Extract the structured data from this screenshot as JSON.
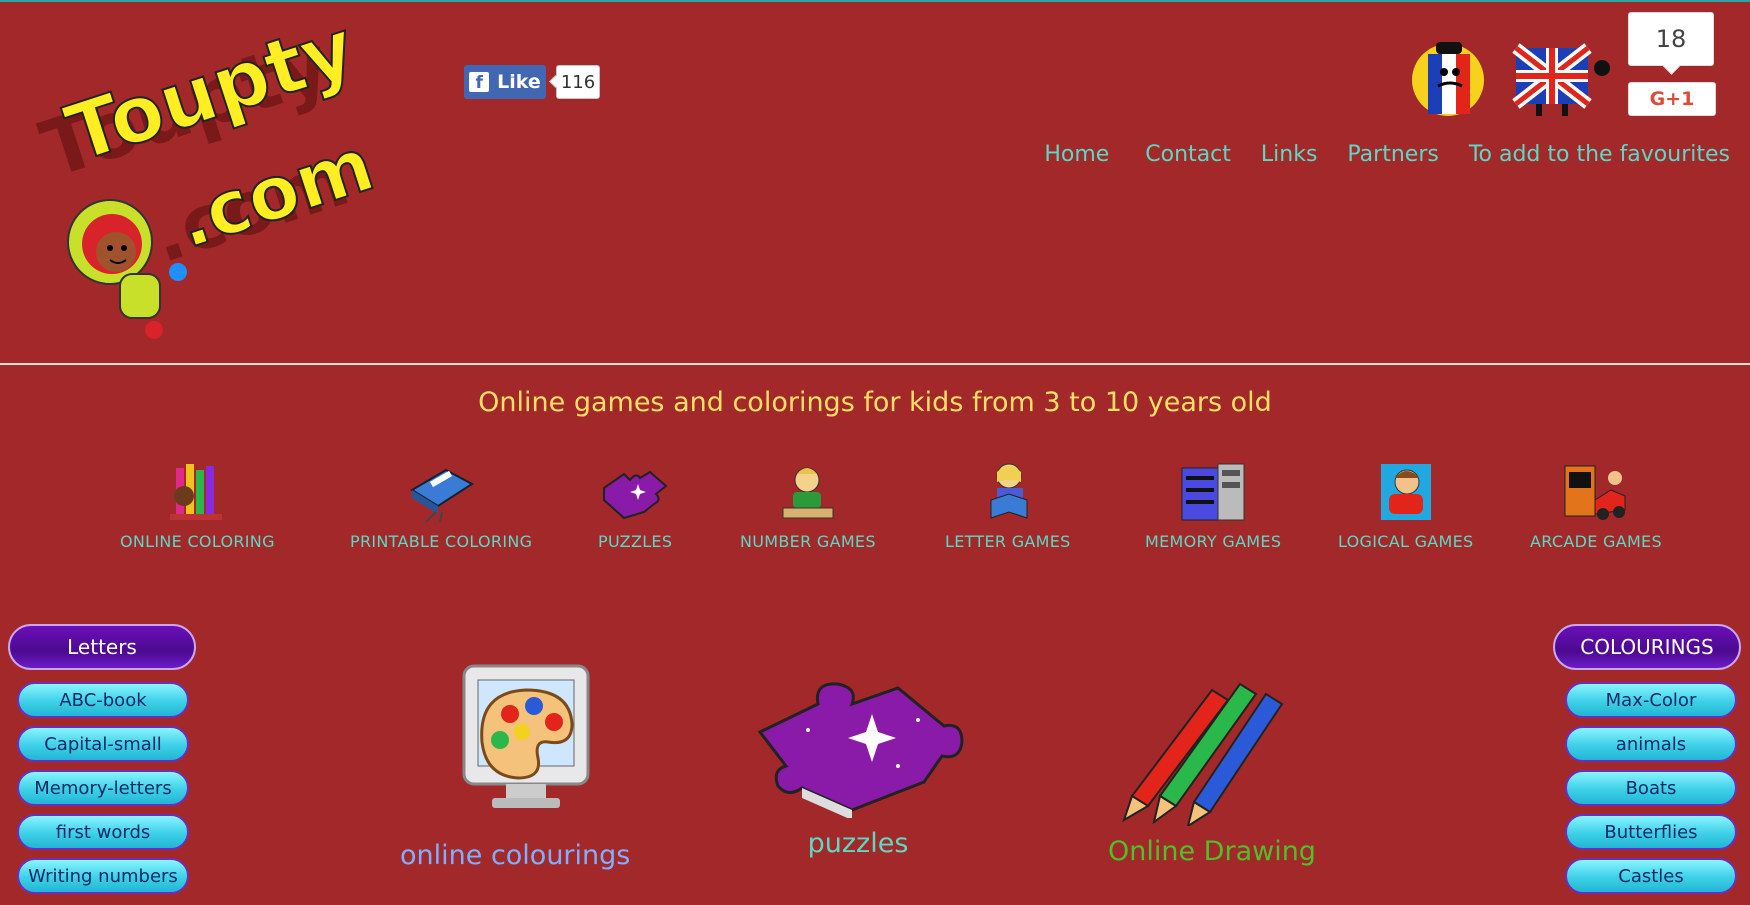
{
  "logo": {
    "text_line1": "Toupty",
    "text_line2": ".com"
  },
  "facebook": {
    "like_label": "Like",
    "like_count": "116"
  },
  "gplus": {
    "count": "18",
    "button_label": "G+1"
  },
  "top_nav": [
    "Home",
    "Contact",
    "Links",
    "Partners",
    "To add to the favourites"
  ],
  "tagline": "Online games and colorings for kids from 3 to 10 years old",
  "categories": [
    {
      "label": "ONLINE COLORING",
      "icon": "crayons-icon"
    },
    {
      "label": "PRINTABLE COLORING",
      "icon": "printer-icon"
    },
    {
      "label": "PUZZLES",
      "icon": "puzzle-icon"
    },
    {
      "label": "NUMBER GAMES",
      "icon": "kid-writing-icon"
    },
    {
      "label": "LETTER GAMES",
      "icon": "reading-girl-icon"
    },
    {
      "label": "MEMORY GAMES",
      "icon": "mega-memory-icon"
    },
    {
      "label": "LOGICAL GAMES",
      "icon": "kid-thinking-icon"
    },
    {
      "label": "ARCADE GAMES",
      "icon": "arcade-car-icon"
    }
  ],
  "left_menu": {
    "title": "Letters",
    "items": [
      "ABC-book",
      "Capital-small",
      "Memory-letters",
      "first words",
      "Writing numbers"
    ]
  },
  "right_menu": {
    "title": "COLOURINGS",
    "items": [
      "Max-Color",
      "animals",
      "Boats",
      "Butterflies",
      "Castles"
    ]
  },
  "tiles": [
    {
      "label": "online colourings",
      "color": "#7fb0ff",
      "icon": "monitor-palette-icon"
    },
    {
      "label": "puzzles",
      "color": "#5cd8c4",
      "icon": "puzzle-piece-icon"
    },
    {
      "label": "Online Drawing",
      "color": "#4fbf2a",
      "icon": "colored-pencils-icon"
    }
  ],
  "colors": {
    "background": "#a3282a",
    "nav": "#5cd8c4",
    "tagline": "#ffe066"
  }
}
